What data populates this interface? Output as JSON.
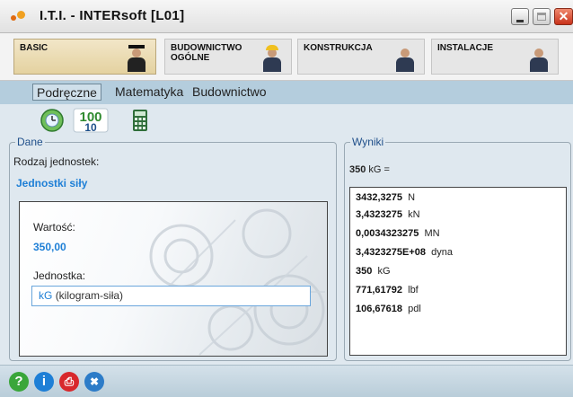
{
  "window": {
    "title": "I.T.I. - INTERsoft [L01]"
  },
  "categories": [
    {
      "label": "BASIC",
      "active": true
    },
    {
      "label": "BUDOWNICTWO\nOGÓLNE",
      "active": false
    },
    {
      "label": "KONSTRUKCJA",
      "active": false
    },
    {
      "label": "INSTALACJE",
      "active": false
    }
  ],
  "subtabs": [
    {
      "label": "Podręczne",
      "active": true
    },
    {
      "label": "Matematyka",
      "active": false
    },
    {
      "label": "Budownictwo",
      "active": false
    }
  ],
  "toolbar": {
    "buttons": [
      {
        "icon": "globe-clock-icon"
      },
      {
        "icon": "number-100-icon",
        "text": "100"
      },
      {
        "icon": "calculator-icon"
      }
    ]
  },
  "dane": {
    "legend": "Dane",
    "unit_type_label": "Rodzaj jednostek:",
    "unit_type_value": "Jednostki siły",
    "value_label": "Wartość:",
    "value": "350,00",
    "unit_label": "Jednostka:",
    "unit_code": "kG",
    "unit_name": "(kilogram-siła)"
  },
  "wyniki": {
    "legend": "Wyniki",
    "summary_value": "350",
    "summary_unit": "kG =",
    "results": [
      {
        "value": "3432,3275",
        "unit": "N"
      },
      {
        "value": "3,4323275",
        "unit": "kN"
      },
      {
        "value": "0,0034323275",
        "unit": "MN"
      },
      {
        "value": "3,4323275E+08",
        "unit": "dyna"
      },
      {
        "value": "350",
        "unit": "kG"
      },
      {
        "value": "771,61792",
        "unit": "lbf"
      },
      {
        "value": "106,67618",
        "unit": "pdl"
      }
    ]
  },
  "statusbar": {
    "icons": [
      {
        "icon": "help-icon",
        "glyph": "?",
        "color": "#3aa63a"
      },
      {
        "icon": "info-icon",
        "glyph": "i",
        "color": "#1e7fd6"
      },
      {
        "icon": "print-icon",
        "glyph": "⎙",
        "color": "#d8282c"
      },
      {
        "icon": "tools-icon",
        "glyph": "✖",
        "color": "#2d7cc8"
      }
    ]
  },
  "colors": {
    "accent_blue": "#1e7fd6",
    "subbar": "#b4cddd",
    "background": "#dfe8ef"
  }
}
